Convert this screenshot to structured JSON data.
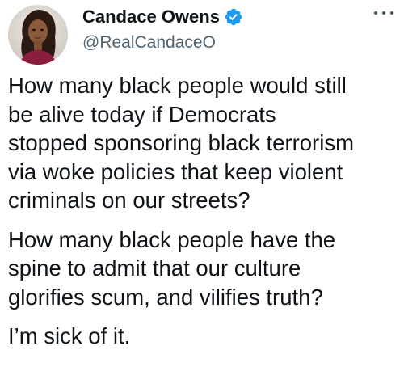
{
  "author": {
    "display_name": "Candace Owens",
    "handle": "@RealCandaceO",
    "verified_icon": "verified-badge-icon",
    "avatar": "profile-photo"
  },
  "menu": {
    "icon": "more-options-icon"
  },
  "tweet": {
    "paragraphs": [
      "How many black people would still\nbe alive today if Democrats\nstopped sponsoring black terrorism\nvia woke policies that keep violent\ncriminals on our streets?",
      "How many black people have the\nspine to admit that our culture\nglorifies scum, and vilifies truth?",
      "I’m sick of it."
    ]
  },
  "colors": {
    "text": "#0f1419",
    "secondary": "#536471",
    "verified": "#1d9bf0"
  }
}
